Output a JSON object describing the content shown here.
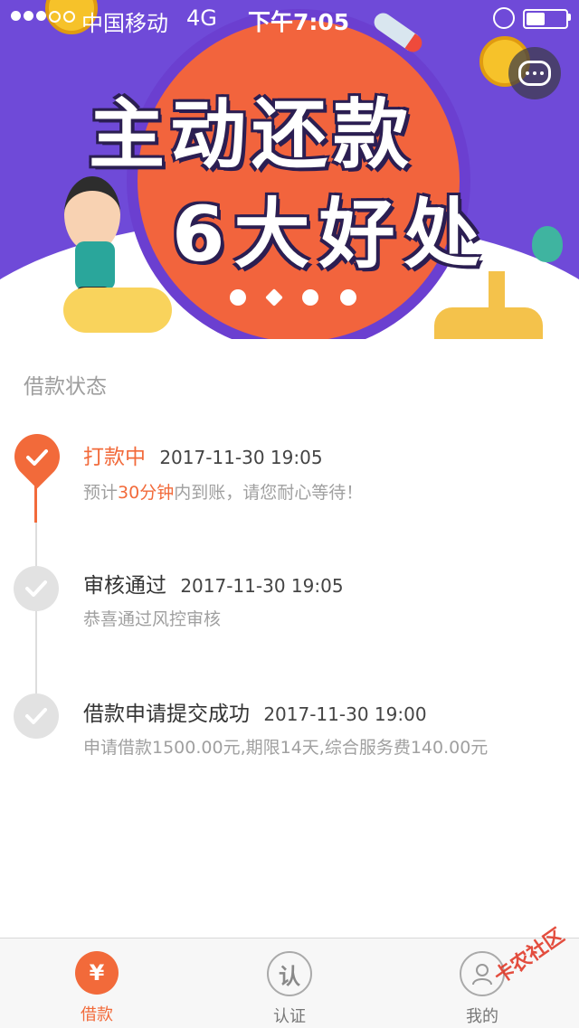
{
  "status_bar": {
    "carrier": "中国移动",
    "network": "4G",
    "time": "下午7:05"
  },
  "banner": {
    "headline_line1": "主动还款",
    "headline_line2": "6大好处",
    "icons": [
      "chat-icon",
      "coin-icon",
      "rocket-icon",
      "balloon-icon"
    ],
    "pager_count": 4,
    "pager_active": 2
  },
  "section": {
    "title": "借款状态"
  },
  "timeline": [
    {
      "status": "打款中",
      "time": "2017-11-30 19:05",
      "desc_prefix": "预计",
      "desc_highlight": "30分钟",
      "desc_suffix": "内到账，请您耐心等待！",
      "active": true
    },
    {
      "status": "审核通过",
      "time": "2017-11-30 19:05",
      "desc": "恭喜通过风控审核",
      "active": false
    },
    {
      "status": "借款申请提交成功",
      "time": "2017-11-30 19:00",
      "desc": "申请借款1500.00元,期限14天,综合服务费140.00元",
      "active": false
    }
  ],
  "tabbar": {
    "tabs": [
      {
        "label": "借款",
        "icon_text": "¥",
        "icon": "yen-icon",
        "active": true
      },
      {
        "label": "认证",
        "icon_text": "认",
        "icon": "verify-icon",
        "active": false
      },
      {
        "label": "我的",
        "icon_text": "",
        "icon": "user-icon",
        "active": false
      }
    ]
  },
  "watermark": "卡农社区",
  "colors": {
    "accent": "#f26a3a",
    "banner_bg": "#6f4ad8",
    "muted_text": "#a0a0a0"
  }
}
